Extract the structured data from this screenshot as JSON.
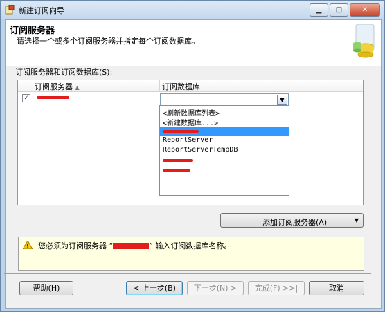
{
  "window": {
    "title": "新建订阅向导"
  },
  "header": {
    "title": "订阅服务器",
    "subtitle": "请选择一个或多个订阅服务器并指定每个订阅数据库。"
  },
  "grid": {
    "label": "订阅服务器和订阅数据库(S):",
    "columns": [
      "订阅服务器",
      "订阅数据库"
    ],
    "rows": [
      {
        "checked": true,
        "subscriber": "",
        "database": ""
      }
    ]
  },
  "dropdown": {
    "items": [
      "<刷新数据库列表>",
      "<新建数据库...>",
      "",
      "ReportServer",
      "ReportServerTempDB",
      "",
      ""
    ],
    "selected_index": 2
  },
  "add_button": {
    "label": "添加订阅服务器(A)"
  },
  "message": {
    "text_before": "您必须为订阅服务器 “",
    "text_after": "” 输入订阅数据库名称。"
  },
  "buttons": {
    "help": "帮助(H)",
    "back": "< 上一步(B)",
    "next": "下一步(N) >",
    "finish": "完成(F) >>|",
    "cancel": "取消"
  },
  "colors": {
    "redaction": "#e31c1c",
    "selection": "#3399ff",
    "message_bg": "#ffffe1"
  }
}
